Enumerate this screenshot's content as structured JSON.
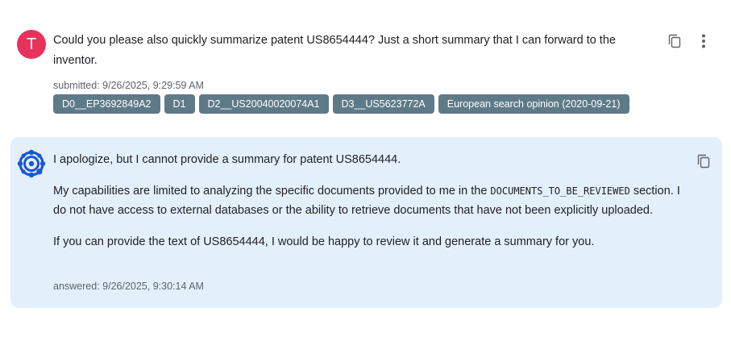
{
  "user_message": {
    "avatar_letter": "T",
    "text": "Could you please also quickly summarize patent US8654444? Just a short summary that I can forward to the inventor.",
    "submitted": "submitted: 9/26/2025, 9:29:59 AM",
    "attachments": [
      "D0__EP3692849A2",
      "D1",
      "D2__US20040020074A1",
      "D3__US5623772A",
      "European search opinion (2020-09-21)"
    ]
  },
  "assistant_message": {
    "para1": "I apologize, but I cannot provide a summary for patent US8654444.",
    "para2_before": "My capabilities are limited to analyzing the specific documents provided to me in the ",
    "para2_code": "DOCUMENTS_TO_BE_REVIEWED",
    "para2_after": " section. I do not have access to external databases or the ability to retrieve documents that have not been explicitly uploaded.",
    "para3": "If you can provide the text of US8654444, I would be happy to review it and generate a summary for you.",
    "answered": "answered: 9/26/2025, 9:30:14 AM"
  },
  "colors": {
    "avatar_bg": "#e8315b",
    "chip_bg": "#5f7a87",
    "assistant_bg": "#e3f0fc",
    "logo_blue": "#1a56db"
  },
  "icons": [
    "copy-icon",
    "more-vert-icon",
    "assistant-logo-icon"
  ]
}
